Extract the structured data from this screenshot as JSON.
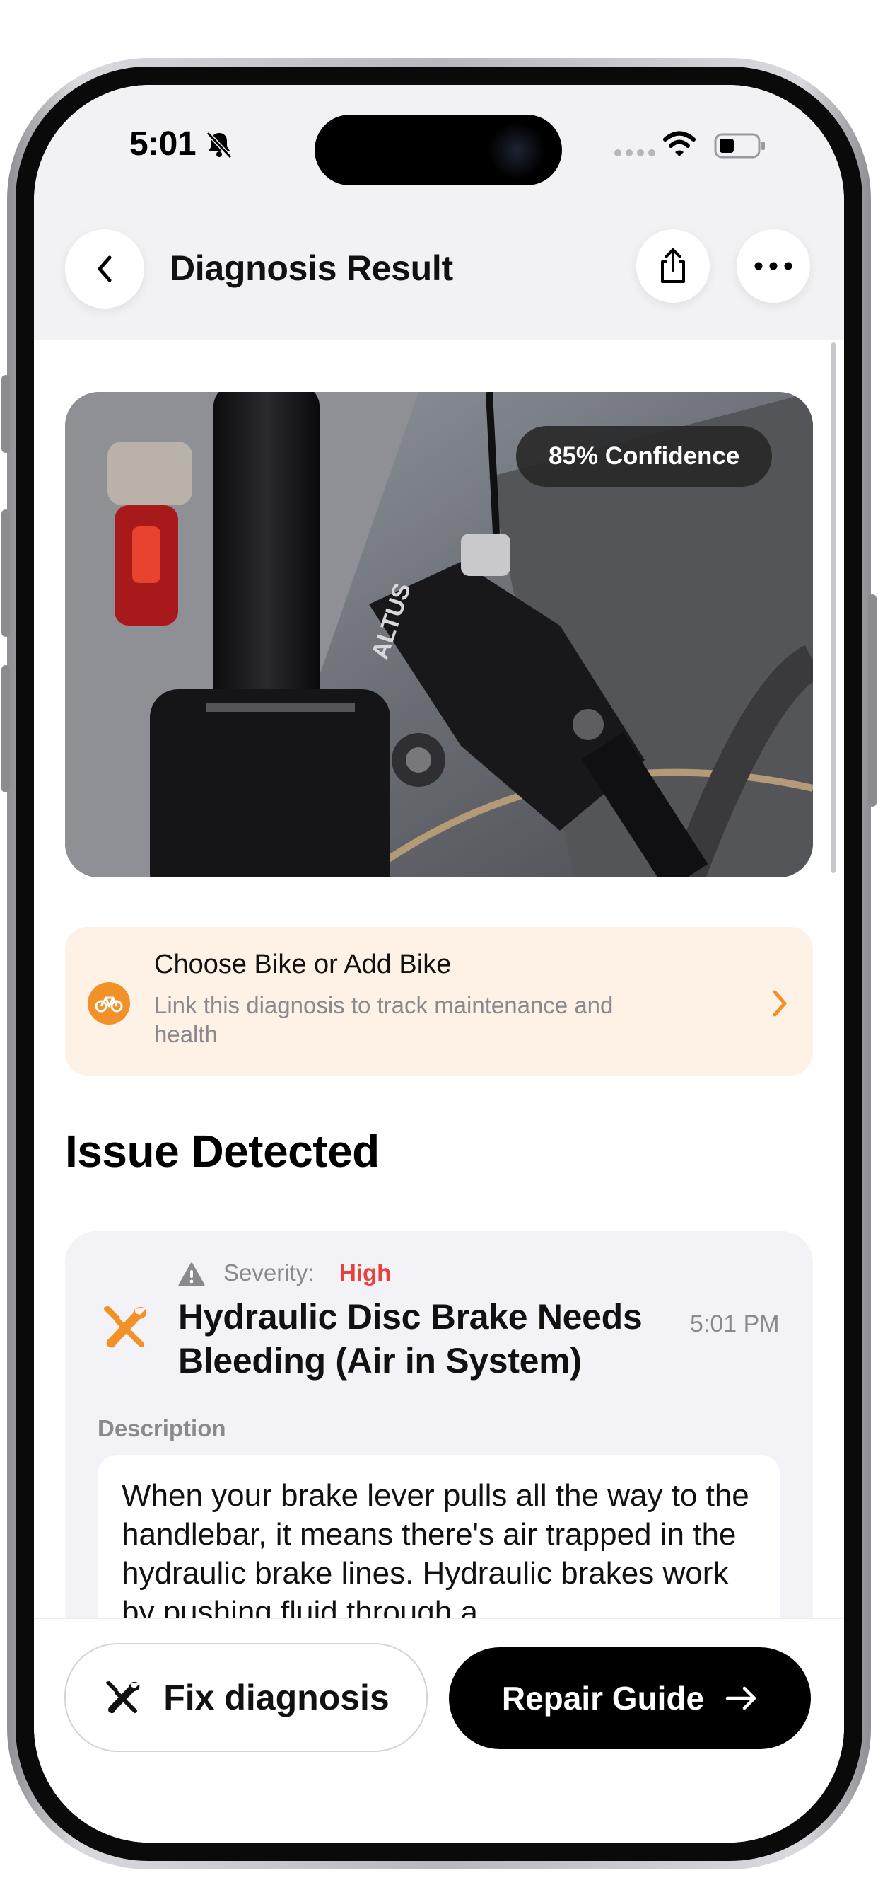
{
  "status_bar": {
    "time": "5:01"
  },
  "header": {
    "title": "Diagnosis Result"
  },
  "photo": {
    "confidence_badge": "85% Confidence"
  },
  "bike_card": {
    "title": "Choose Bike or Add Bike",
    "subtitle": "Link this diagnosis to track maintenance and health"
  },
  "issue_section": {
    "heading": "Issue Detected"
  },
  "issue": {
    "severity_label": "Severity:",
    "severity_value": "High",
    "title": "Hydraulic Disc Brake Needs Bleeding (Air in System)",
    "time": "5:01 PM",
    "description_label": "Description",
    "description": "When your brake lever pulls all the way to the handlebar, it means there's air trapped in the hydraulic brake lines. Hydraulic brakes work by pushing fluid through a"
  },
  "actions": {
    "fix_label": "Fix diagnosis",
    "repair_label": "Repair Guide"
  },
  "colors": {
    "accent_orange": "#f29128",
    "severity_high": "#e8413a",
    "card_bg": "#f2f2f7",
    "bike_card_bg": "#fef1e6"
  }
}
